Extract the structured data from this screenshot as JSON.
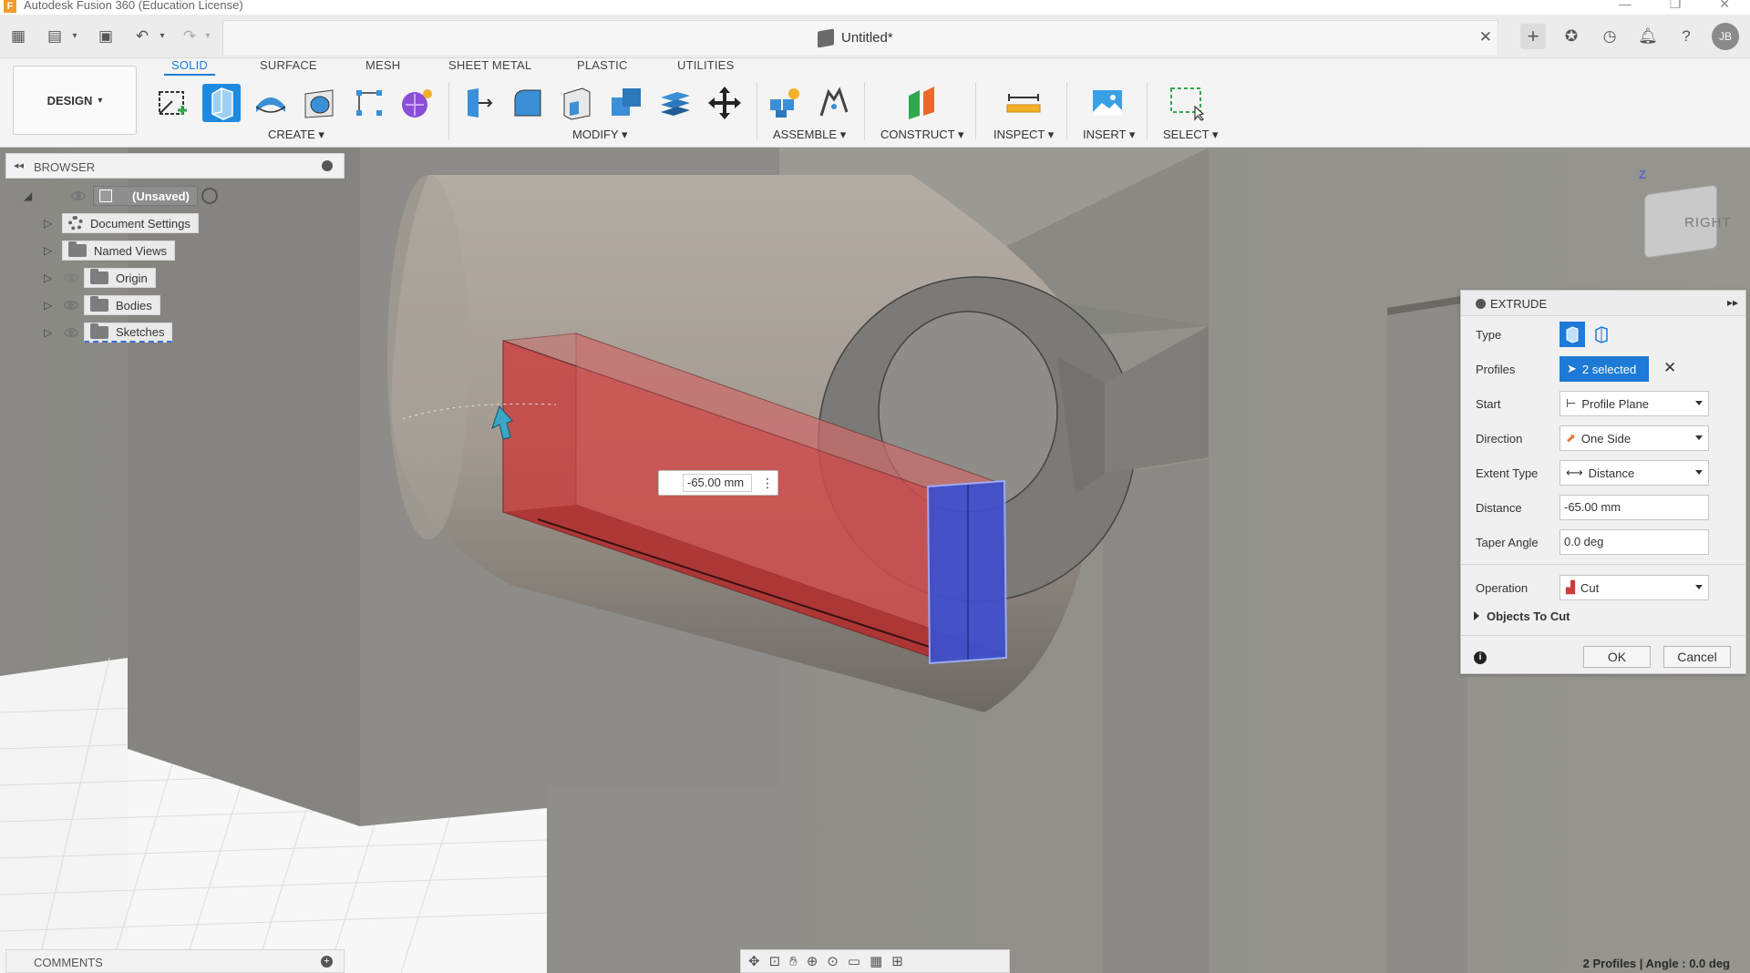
{
  "window": {
    "app_title": "Autodesk Fusion 360 (Education License)"
  },
  "document": {
    "title": "Untitled*"
  },
  "user": {
    "initials": "JB"
  },
  "ribbon": {
    "workspace": "DESIGN",
    "tabs": [
      "SOLID",
      "SURFACE",
      "MESH",
      "SHEET METAL",
      "PLASTIC",
      "UTILITIES"
    ],
    "active_tab": "SOLID",
    "groups": [
      "CREATE",
      "MODIFY",
      "ASSEMBLE",
      "CONSTRUCT",
      "INSPECT",
      "INSERT",
      "SELECT"
    ]
  },
  "browser": {
    "title": "BROWSER",
    "items": [
      {
        "label": "(Unsaved)"
      },
      {
        "label": "Document Settings"
      },
      {
        "label": "Named Views"
      },
      {
        "label": "Origin"
      },
      {
        "label": "Bodies"
      },
      {
        "label": "Sketches"
      }
    ]
  },
  "viewport": {
    "dimension_value": "-65.00 mm",
    "viewcube_face": "RIGHT",
    "axis_z": "Z"
  },
  "extrude": {
    "title": "EXTRUDE",
    "rows": {
      "type_label": "Type",
      "profiles_label": "Profiles",
      "profiles_value": "2 selected",
      "start_label": "Start",
      "start_value": "Profile Plane",
      "direction_label": "Direction",
      "direction_value": "One Side",
      "extent_label": "Extent Type",
      "extent_value": "Distance",
      "distance_label": "Distance",
      "distance_value": "-65.00 mm",
      "taper_label": "Taper Angle",
      "taper_value": "0.0 deg",
      "operation_label": "Operation",
      "operation_value": "Cut"
    },
    "objects_to_cut": "Objects To Cut",
    "ok": "OK",
    "cancel": "Cancel"
  },
  "comments": {
    "title": "COMMENTS"
  },
  "status": {
    "text": "2 Profiles | Angle : 0.0 deg"
  },
  "colors": {
    "accent": "#1d7ad6",
    "profile_blue": "#3a4fd0",
    "cut_red": "#cc3b3b",
    "body_gray": "#8f8e8a"
  }
}
